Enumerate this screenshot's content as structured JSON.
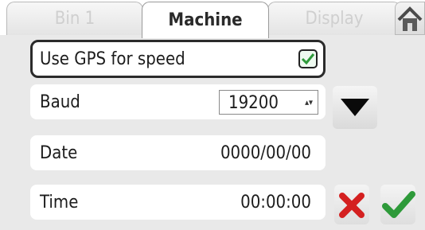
{
  "tabs": [
    {
      "label": "Bin 1",
      "active": false
    },
    {
      "label": "Machine",
      "active": true
    },
    {
      "label": "Display",
      "active": false
    }
  ],
  "home_icon": "home-icon",
  "settings": {
    "gps": {
      "label": "Use GPS for speed",
      "checked": true
    },
    "baud": {
      "label": "Baud",
      "value": "19200"
    },
    "date": {
      "label": "Date",
      "value": "0000/00/00"
    },
    "time": {
      "label": "Time",
      "value": "00:00:00"
    }
  },
  "colors": {
    "check_green": "#2e9a3a",
    "cancel_red": "#d42020"
  }
}
